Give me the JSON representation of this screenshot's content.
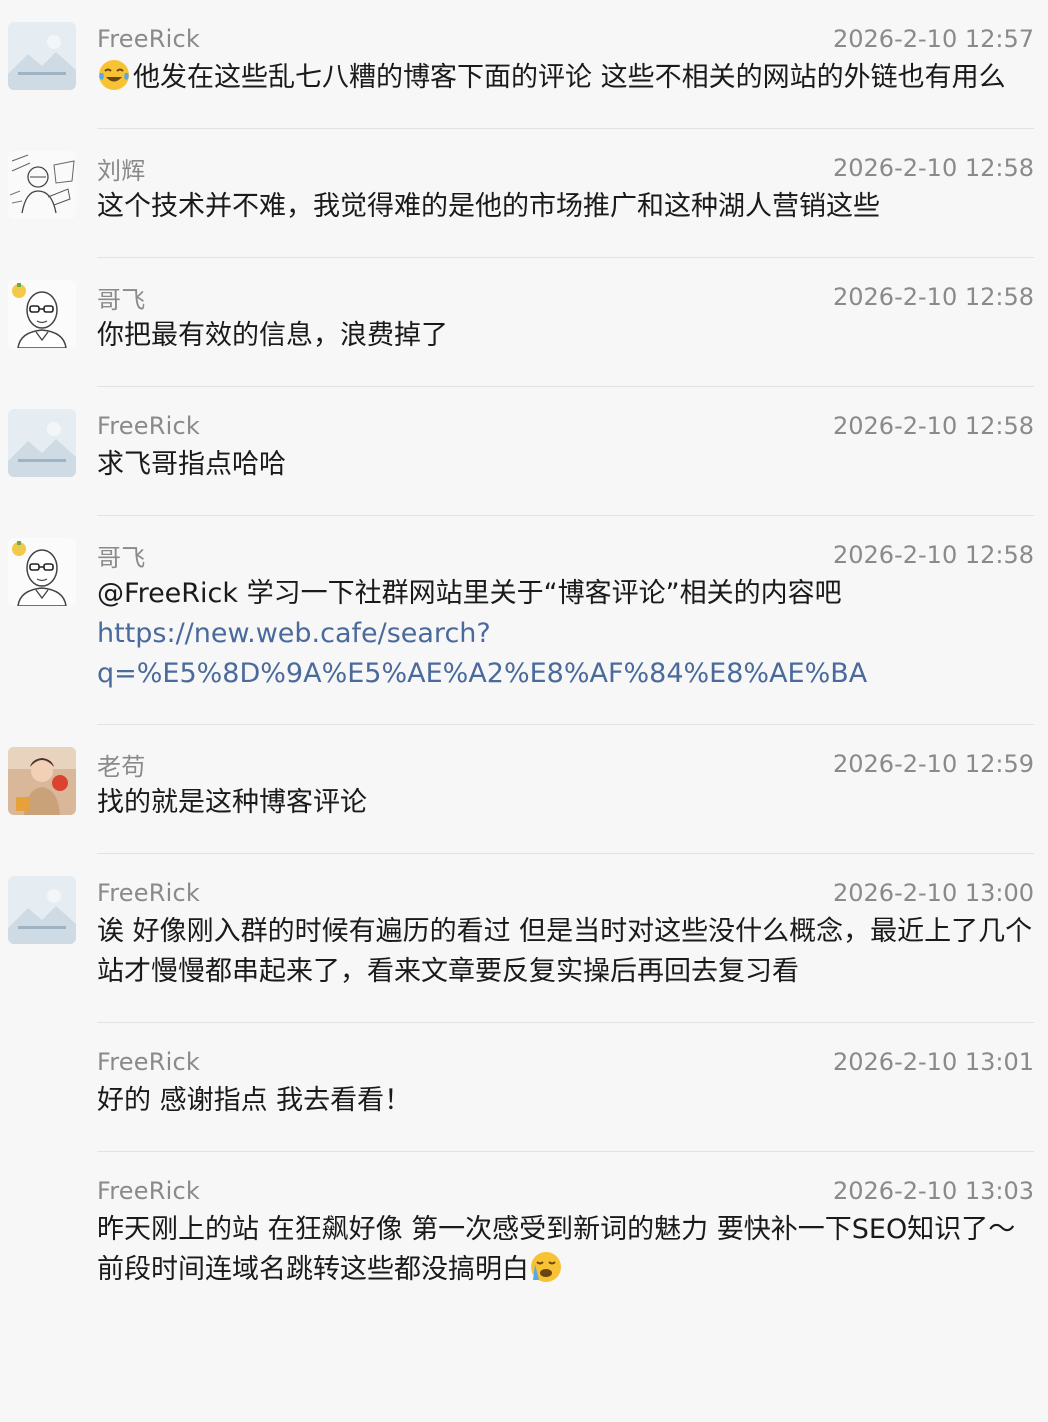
{
  "messages": [
    {
      "user": "FreeRick",
      "time": "2026-2-10 12:57",
      "avatar": "placeholder-image-icon",
      "emoji_before": "tears-of-joy-emoji",
      "text": "他发在这些乱七八糟的博客下面的评论 这些不相关的网站的外链也有用么"
    },
    {
      "user": "刘辉",
      "time": "2026-2-10 12:58",
      "avatar": "sketch-avatar",
      "text": "这个技术并不难，我觉得难的是他的市场推广和这种湖人营销这些"
    },
    {
      "user": "哥飞",
      "time": "2026-2-10 12:58",
      "avatar": "bald-glasses-avatar",
      "text": "你把最有效的信息，浪费掉了"
    },
    {
      "user": "FreeRick",
      "time": "2026-2-10 12:58",
      "avatar": "placeholder-image-icon",
      "text": "求飞哥指点哈哈"
    },
    {
      "user": "哥飞",
      "time": "2026-2-10 12:58",
      "avatar": "bald-glasses-avatar",
      "text": "@FreeRick 学习一下社群网站里关于“博客评论”相关的内容吧",
      "link_line1": "https://new.web.cafe/search?",
      "link_line2": "q=%E5%8D%9A%E5%AE%A2%E8%AF%84%E8%AE%BA"
    },
    {
      "user": "老苟",
      "time": "2026-2-10 12:59",
      "avatar": "photo-avatar",
      "text": "找的就是这种博客评论"
    },
    {
      "user": "FreeRick",
      "time": "2026-2-10 13:00",
      "avatar": "placeholder-image-icon",
      "text": "诶 好像刚入群的时候有遍历的看过 但是当时对这些没什么概念，最近上了几个站才慢慢都串起来了，看来文章要反复实操后再回去复习看"
    },
    {
      "user": "FreeRick",
      "time": "2026-2-10 13:01",
      "avatar": "",
      "text": "好的 感谢指点 我去看看！"
    },
    {
      "user": "FreeRick",
      "time": "2026-2-10 13:03",
      "avatar": "",
      "text": "昨天刚上的站 在狂飙好像 第一次感受到新词的魅力 要快补一下SEO知识了～ 前段时间连域名跳转这些都没搞明白",
      "emoji_after": "crying-emoji"
    }
  ],
  "colors": {
    "background": "#f7f7f7",
    "meta": "#8a8a8a",
    "link": "#4a6a9c",
    "separator": "#e2e2e2"
  }
}
